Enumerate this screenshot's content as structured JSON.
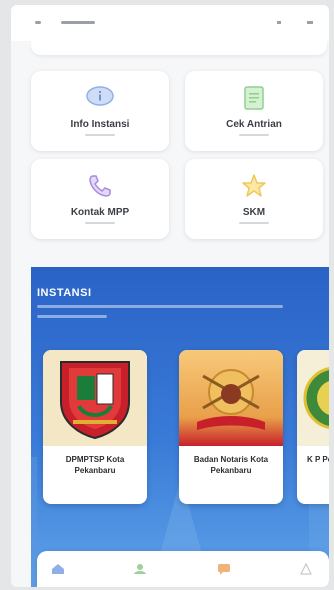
{
  "menu": [
    {
      "label": "Info Instansi",
      "icon": "info-icon"
    },
    {
      "label": "Cek Antrian",
      "icon": "queue-icon"
    },
    {
      "label": "Kontak MPP",
      "icon": "phone-icon"
    },
    {
      "label": "SKM",
      "icon": "star-icon"
    }
  ],
  "instansi": {
    "title": "INSTANSI",
    "agencies": [
      {
        "name": "DPMPTSP Kota Pekanbaru",
        "logo": "pekanbaru-emblem-icon"
      },
      {
        "name": "Badan Notaris Kota Pekanbaru",
        "logo": "ini-emblem-icon"
      },
      {
        "name": "K P Pe MA",
        "logo": "green-seal-icon"
      }
    ]
  },
  "bottom_nav": [
    {
      "icon": "home-icon"
    },
    {
      "icon": "users-icon"
    },
    {
      "icon": "chat-icon"
    },
    {
      "icon": "profile-icon"
    }
  ],
  "colors": {
    "accent_blue": "#2a63c6",
    "icon_blue": "#8fb0e6",
    "icon_green": "#8fd08f",
    "icon_purple": "#a78ae0",
    "icon_gold": "#f0c85a"
  }
}
